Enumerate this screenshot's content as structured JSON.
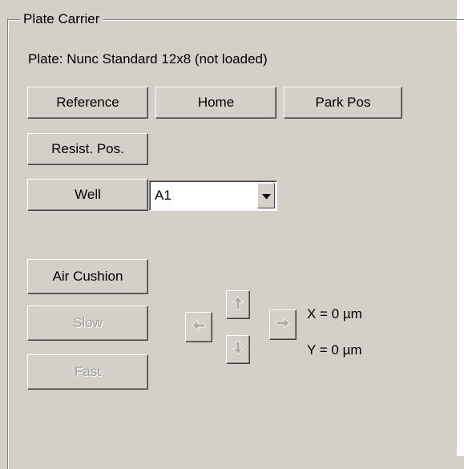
{
  "group": {
    "title": "Plate Carrier"
  },
  "plate": {
    "label": "Plate: Nunc Standard 12x8 (not loaded)"
  },
  "buttons": {
    "reference": "Reference",
    "home": "Home",
    "park_pos": "Park Pos",
    "resist_pos": "Resist. Pos.",
    "well": "Well",
    "air_cushion": "Air Cushion",
    "slow": "Slow",
    "fast": "Fast"
  },
  "well_select": {
    "value": "A1"
  },
  "position": {
    "x": "X = 0 µm",
    "y": "Y = 0 µm"
  },
  "colors": {
    "panel_bg": "#d4d0c8",
    "disabled_text": "#a0a0a0",
    "arrow_gray": "#b0aca4"
  },
  "icons": {
    "up": "arrow-up-icon",
    "down": "arrow-down-icon",
    "left": "arrow-left-icon",
    "right": "arrow-right-icon",
    "dropdown": "chevron-down-icon"
  }
}
